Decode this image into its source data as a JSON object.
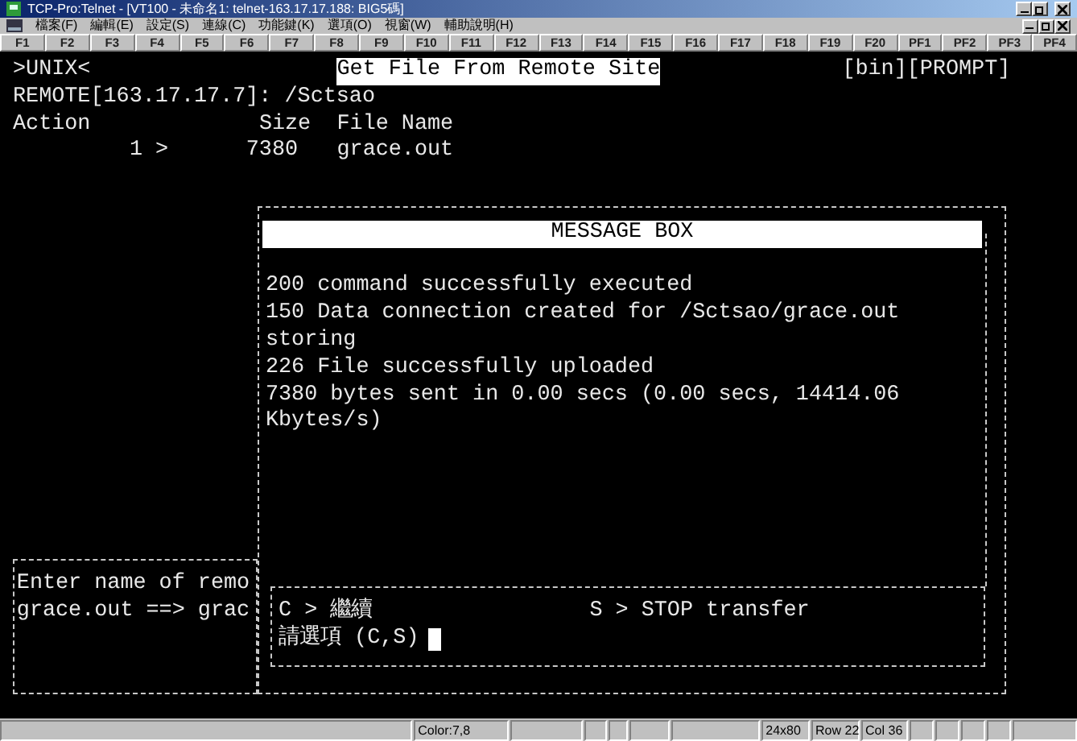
{
  "window": {
    "title": "TCP-Pro:Telnet - [VT100 - 未命名1: telnet-163.17.17.188: BIG5碼]"
  },
  "menu": [
    "檔案(F)",
    "編輯(E)",
    "設定(S)",
    "連線(C)",
    "功能鍵(K)",
    "選項(O)",
    "視窗(W)",
    "輔助說明(H)"
  ],
  "function_keys": [
    "F1",
    "F2",
    "F3",
    "F4",
    "F5",
    "F6",
    "F7",
    "F8",
    "F9",
    "F10",
    "F11",
    "F12",
    "F13",
    "F14",
    "F15",
    "F16",
    "F17",
    "F18",
    "F19",
    "F20",
    "PF1",
    "PF2",
    "PF3",
    "PF4"
  ],
  "terminal": {
    "mode": ">UNIX<",
    "screen_title": "Get File From Remote Site",
    "flags": "[bin][PROMPT]",
    "path": "REMOTE[163.17.17.7]: /Sctsao",
    "columns": [
      "Action",
      "Size",
      "File Name"
    ],
    "files": [
      {
        "action": "1 >",
        "size": "7380",
        "name": "grace.out"
      }
    ],
    "message_box": {
      "title": "MESSAGE BOX",
      "lines": [
        "200 command successfully executed",
        "150 Data connection created for /Sctsao/grace.out",
        "storing",
        "226 File successfully uploaded",
        "7380 bytes sent in 0.00 secs (0.00 secs, 14414.06",
        "Kbytes/s)"
      ]
    },
    "input_panel": [
      "Enter name of remo",
      "grace.out ==> grac"
    ],
    "options": [
      "C > 繼續",
      "S > STOP transfer"
    ],
    "prompt": "請選項 (C,S)"
  },
  "status_bar": [
    "Color:7,8",
    "24x80",
    "Row 22",
    "Col 36"
  ]
}
